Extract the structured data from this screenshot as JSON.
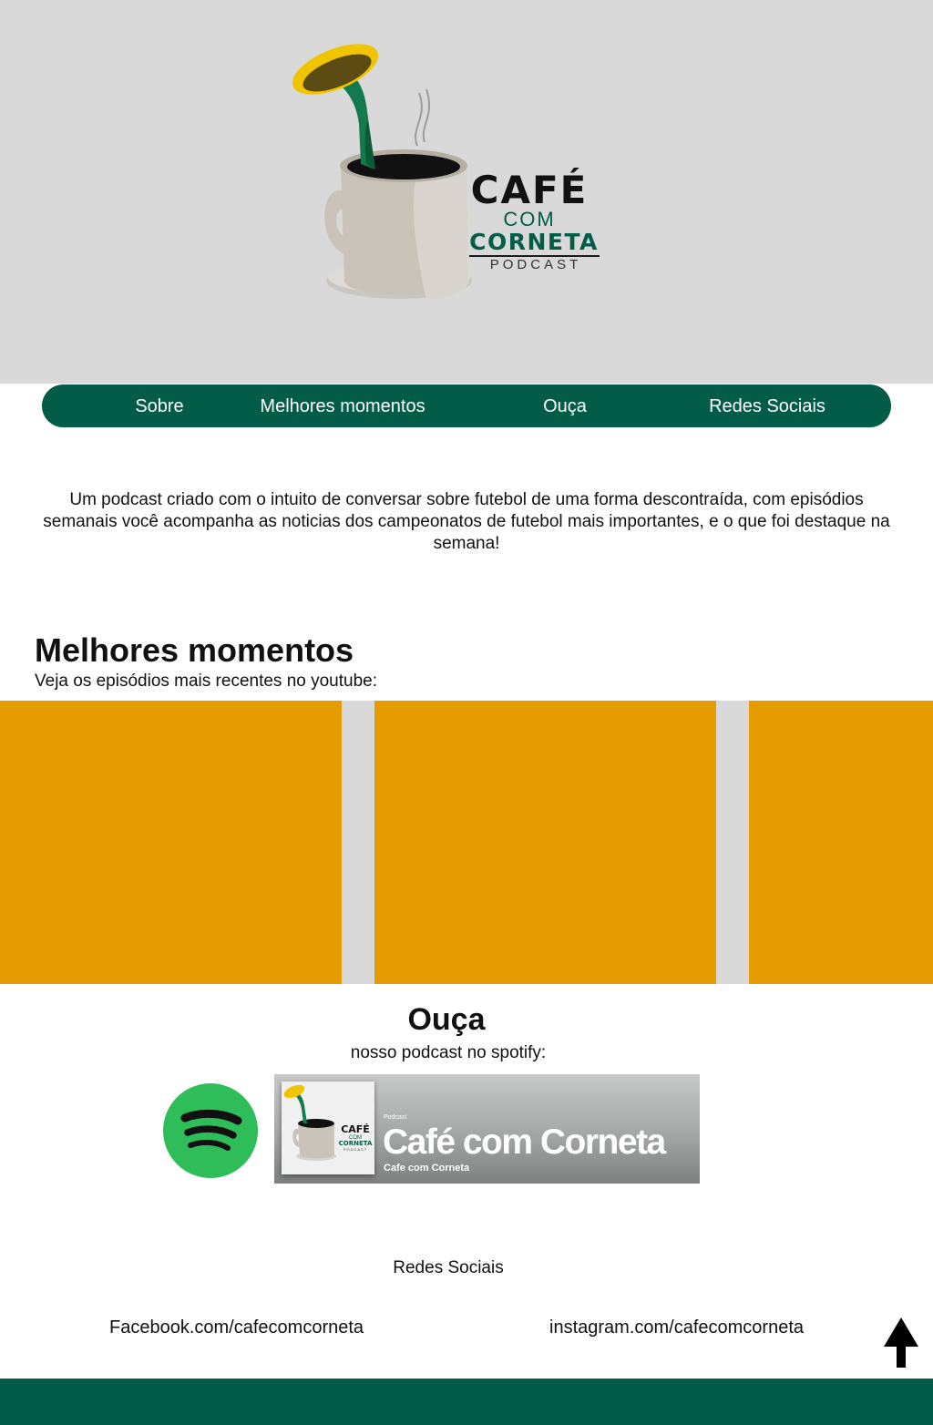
{
  "brand": {
    "line1": "CAFÉ",
    "line2": "COM",
    "line3": "CORNETA",
    "line4": "PODCAST"
  },
  "nav": {
    "items": [
      {
        "label": "Sobre"
      },
      {
        "label": "Melhores momentos"
      },
      {
        "label": "Ouça"
      },
      {
        "label": "Redes Sociais"
      }
    ]
  },
  "about": {
    "text": "Um podcast criado com o intuito de conversar sobre futebol de uma forma descontraída, com episódios semanais você acompanha as noticias dos campeonatos de futebol mais importantes, e o que foi destaque na semana!"
  },
  "highlights": {
    "title": "Melhores momentos",
    "subtitle": "Veja os episódios mais recentes no youtube:"
  },
  "listen": {
    "title": "Ouça",
    "subtitle": "nosso podcast no spotify:",
    "banner": {
      "kicker": "Podcast",
      "title": "Café com Corneta",
      "author": "Cafe com Corneta"
    }
  },
  "social": {
    "title": "Redes Sociais",
    "facebook": "Facebook.com/cafecomcorneta",
    "instagram": "instagram.com/cafecomcorneta"
  },
  "icons": {
    "spotify": "spotify-icon",
    "back_to_top": "arrow-up-icon"
  },
  "colors": {
    "primary_green": "#025c47",
    "accent_orange": "#e59c00",
    "hero_gray": "#d9d9d9",
    "spotify_green": "#2ebd59"
  }
}
